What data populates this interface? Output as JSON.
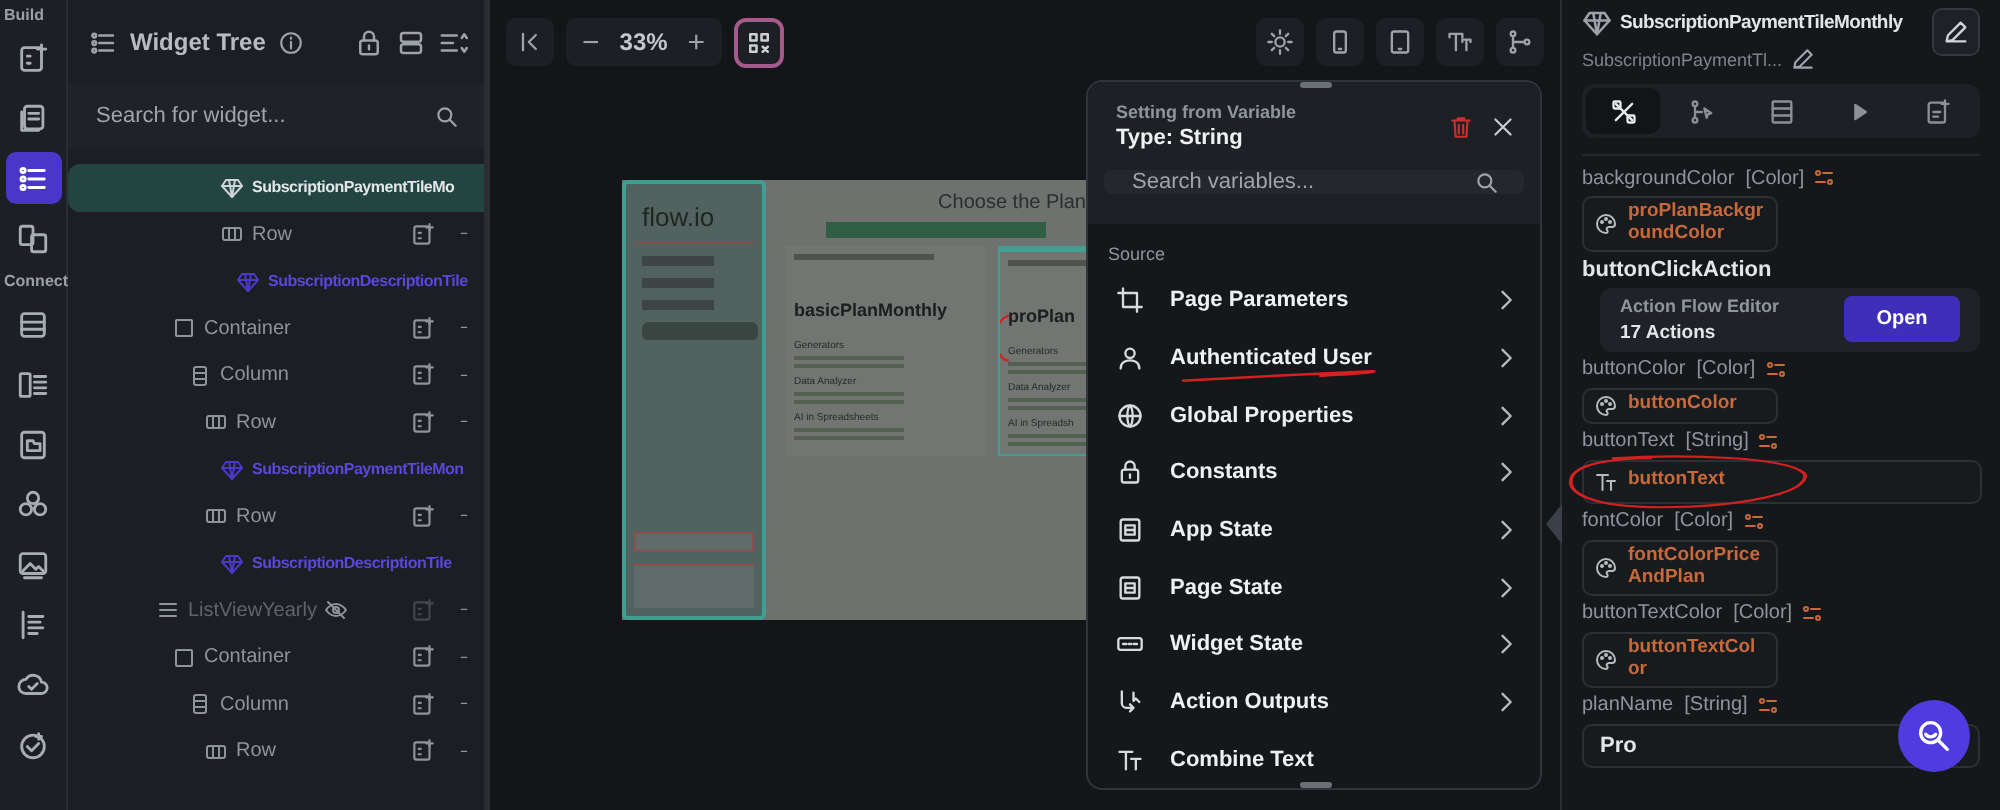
{
  "rail": {
    "sections": [
      {
        "label": "Build",
        "items": [
          {
            "kind": "add-widget",
            "selected": false
          },
          {
            "kind": "pages",
            "selected": false
          },
          {
            "kind": "tree",
            "selected": true
          },
          {
            "kind": "devices",
            "selected": false
          }
        ]
      },
      {
        "label": "Connect",
        "items": [
          {
            "kind": "table",
            "selected": false
          },
          {
            "kind": "schema",
            "selected": false
          },
          {
            "kind": "folder",
            "selected": false
          },
          {
            "kind": "circles",
            "selected": false
          },
          {
            "kind": "image",
            "selected": false
          },
          {
            "kind": "list",
            "selected": false
          },
          {
            "kind": "cloud",
            "selected": false
          },
          {
            "kind": "check-badge",
            "selected": false
          }
        ]
      }
    ]
  },
  "widget_tree": {
    "title": "Widget Tree",
    "search": {
      "placeholder": "Search for widget..."
    },
    "open_branch": [
      {
        "kind": "component",
        "label": "SubscriptionPaymentTileMo",
        "selected": true,
        "hidden": false
      },
      {
        "kind": "row",
        "label": "Row",
        "selected": false,
        "hidden": false,
        "children": [
          {
            "kind": "component",
            "label": "SubscriptionDescriptionTile",
            "selected": false,
            "hidden": false
          }
        ]
      }
    ],
    "open_parent_items": [
      {
        "kind": "container",
        "label": "Container",
        "selected": false,
        "hidden": false,
        "children": [
          {
            "kind": "column",
            "label": "Column",
            "selected": false,
            "hidden": false,
            "children": [
              {
                "kind": "row",
                "label": "Row",
                "selected": false,
                "hidden": false,
                "children": [
                  {
                    "kind": "component",
                    "label": "SubscriptionPaymentTileMon",
                    "selected": false,
                    "hidden": false
                  }
                ]
              },
              {
                "kind": "row",
                "label": "Row",
                "selected": false,
                "hidden": false,
                "children": [
                  {
                    "kind": "component",
                    "label": "SubscriptionDescriptionTile",
                    "selected": false,
                    "hidden": false
                  }
                ]
              }
            ]
          }
        ]
      }
    ],
    "items": [
      {
        "kind": "listview",
        "label": "ListViewYearly",
        "selected": false,
        "hidden": true,
        "children": [
          {
            "kind": "container",
            "label": "Container",
            "selected": false,
            "hidden": false,
            "children": [
              {
                "kind": "column",
                "label": "Column",
                "selected": false,
                "hidden": false,
                "children": [
                  {
                    "kind": "row",
                    "label": "Row",
                    "selected": false,
                    "hidden": false
                  }
                ]
              }
            ]
          }
        ]
      }
    ]
  },
  "canvas_toolbar": {
    "zoom_out": "−",
    "zoom": "33%",
    "zoom_in": "+"
  },
  "preview": {
    "brand": "flow.io",
    "heading": "Choose the Plan",
    "plans": [
      {
        "title": "basicPlanMonthly",
        "sections": [
          "Generators",
          "Data Analyzer",
          "AI in Spreadsheets"
        ],
        "selected": false,
        "circled": false
      },
      {
        "title": "proPlan",
        "sections": [
          "Generators",
          "Data Analyzer",
          "AI in Spreadsh"
        ],
        "selected": true,
        "circled": true
      }
    ]
  },
  "variable_picker": {
    "title": "Setting from Variable",
    "type": "Type: String",
    "search": {
      "placeholder": "Search variables..."
    },
    "section": "Source",
    "items": [
      {
        "kind": "page-parameters",
        "label": "Page Parameters",
        "submenu": true,
        "underlined": false
      },
      {
        "kind": "user",
        "label": "Authenticated User",
        "submenu": true,
        "underlined": true
      },
      {
        "kind": "globe",
        "label": "Global Properties",
        "submenu": true,
        "underlined": false
      },
      {
        "kind": "lock",
        "label": "Constants",
        "submenu": true,
        "underlined": false
      },
      {
        "kind": "app-state",
        "label": "App State",
        "submenu": true,
        "underlined": false
      },
      {
        "kind": "page-state",
        "label": "Page State",
        "submenu": true,
        "underlined": false
      },
      {
        "kind": "widget-state",
        "label": "Widget State",
        "submenu": true,
        "underlined": false
      },
      {
        "kind": "action-outputs",
        "label": "Action Outputs",
        "submenu": true,
        "underlined": false
      },
      {
        "kind": "combine-text",
        "label": "Combine Text",
        "submenu": false,
        "underlined": false
      }
    ]
  },
  "properties": {
    "title": "SubscriptionPaymentTileMonthly",
    "subtitle": "SubscriptionPaymentTl...",
    "tabs": [
      {
        "kind": "properties",
        "selected": true
      },
      {
        "kind": "actions",
        "selected": false
      },
      {
        "kind": "layout",
        "selected": false
      },
      {
        "kind": "play",
        "selected": false
      },
      {
        "kind": "add-doc",
        "selected": false
      }
    ],
    "params": [
      {
        "kind": "color-binding",
        "name": "backgroundColor",
        "type": "[Color]",
        "value": "proPlanBackgroundColor",
        "circled": false
      },
      {
        "kind": "action",
        "name": "buttonClickAction",
        "card_title": "Action Flow Editor",
        "card_count": "17 Actions",
        "button": "Open",
        "circled": false
      },
      {
        "kind": "color-binding",
        "name": "buttonColor",
        "type": "[Color]",
        "value": "buttonColor",
        "circled": false
      },
      {
        "kind": "text-binding",
        "name": "buttonText",
        "type": "[String]",
        "value": "buttonText",
        "circled": true
      },
      {
        "kind": "color-binding",
        "name": "fontColor",
        "type": "[Color]",
        "value": "fontColorPriceAndPlan",
        "circled": false
      },
      {
        "kind": "color-binding",
        "name": "buttonTextColor",
        "type": "[Color]",
        "value": "buttonTextColor",
        "circled": false
      },
      {
        "kind": "field",
        "name": "planName",
        "type": "[String]",
        "value": "Pro",
        "circled": false
      }
    ]
  }
}
